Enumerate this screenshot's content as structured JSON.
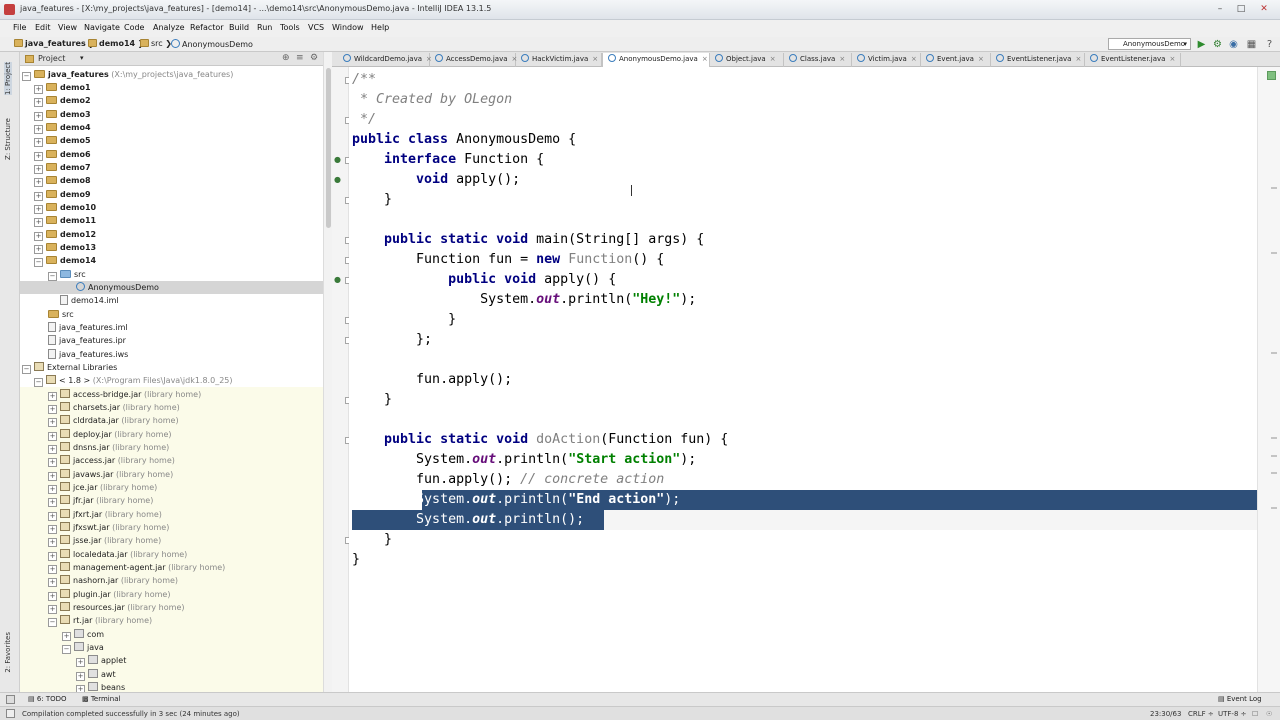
{
  "window": {
    "title": "java_features - [X:\\my_projects\\java_features] - [demo14] - ...\\demo14\\src\\AnonymousDemo.java - IntelliJ IDEA 13.1.5"
  },
  "menu": [
    "File",
    "Edit",
    "View",
    "Navigate",
    "Code",
    "Analyze",
    "Refactor",
    "Build",
    "Run",
    "Tools",
    "VCS",
    "Window",
    "Help"
  ],
  "breadcrumbs": [
    "java_features",
    "demo14",
    "src",
    "AnonymousDemo"
  ],
  "toolbar": {
    "run_config": "AnonymousDemo"
  },
  "side_tabs": {
    "project": "1: Project",
    "structure": "Z: Structure",
    "favorites": "2: Favorites"
  },
  "project_panel": {
    "header": "Project",
    "root": {
      "name": "java_features",
      "path": "(X:\\my_projects\\java_features)"
    },
    "modules": [
      "demo1",
      "demo2",
      "demo3",
      "demo4",
      "demo5",
      "demo6",
      "demo7",
      "demo8",
      "demo9",
      "demo10",
      "demo11",
      "demo12",
      "demo13",
      "demo14"
    ],
    "demo14_src": "src",
    "selected_file": "AnonymousDemo",
    "demo14_iml": "demo14.iml",
    "root_files": [
      "src",
      "java_features.iml",
      "java_features.ipr",
      "java_features.iws"
    ],
    "external_libraries": "External Libraries",
    "jdk": {
      "name": "< 1.8 >",
      "path": "(X:\\Program Files\\Java\\jdk1.8.0_25)"
    },
    "library_home": "(library home)",
    "jars": [
      "access-bridge.jar",
      "charsets.jar",
      "cldrdata.jar",
      "deploy.jar",
      "dnsns.jar",
      "jaccess.jar",
      "javaws.jar",
      "jce.jar",
      "jfr.jar",
      "jfxrt.jar",
      "jfxswt.jar",
      "jsse.jar",
      "localedata.jar",
      "management-agent.jar",
      "nashorn.jar",
      "plugin.jar",
      "resources.jar",
      "rt.jar"
    ],
    "packages": [
      "com",
      "java"
    ],
    "subpackages": [
      "applet",
      "awt",
      "beans"
    ]
  },
  "tabs": [
    "WildcardDemo.java",
    "AccessDemo.java",
    "HackVictim.java",
    "AnonymousDemo.java",
    "Object.java",
    "Class.java",
    "Victim.java",
    "Event.java",
    "EventListener.java",
    "EventListener.java"
  ],
  "code": {
    "l1": "/**",
    "l2": " * Created by OLegon",
    "l3": " */",
    "l4_kw": "public class",
    "l4_rest": " AnonymousDemo {",
    "l5_kw": "interface",
    "l5_rest": " Function {",
    "l6_kw": "void",
    "l6_rest": " apply();",
    "l7": "}",
    "l9_kw": "public static void",
    "l9_rest": " main(String[] args) {",
    "l10_a": "Function fun = ",
    "l10_kw": "new",
    "l10_b": " ",
    "l10_un": "Function",
    "l10_c": "() {",
    "l11_kw": "public void",
    "l11_rest": " apply() {",
    "l12_a": "System.",
    "l12_fd": "out",
    "l12_b": ".println(",
    "l12_st": "\"Hey!\"",
    "l12_c": ");",
    "l13": "}",
    "l14": "};",
    "l16": "fun.apply();",
    "l17": "}",
    "l19_kw": "public static void",
    "l19_un": "doAction",
    "l19_rest": "(Function fun) {",
    "l20_a": "System.",
    "l20_fd": "out",
    "l20_b": ".println(",
    "l20_st": "\"Start action\"",
    "l20_c": ");",
    "l21_a": "fun.apply(); ",
    "l21_cm": "// concrete action",
    "l22_a": "System.",
    "l22_fd": "out",
    "l22_b": ".println(",
    "l22_st": "\"End action\"",
    "l22_c": ");",
    "l23_a": "System.",
    "l23_fd": "out",
    "l23_b": ".println();",
    "l24": "}",
    "l25": "}"
  },
  "bottom_tools": {
    "todo": "6: TODO",
    "terminal": "Terminal",
    "event_log": "Event Log"
  },
  "status": {
    "message": "Compilation completed successfully in 3 sec (24 minutes ago)",
    "position": "23:30/63",
    "line_sep": "CRLF ÷",
    "encoding": "UTF-8 ÷"
  },
  "colors": {
    "selection": "#2e4f79",
    "keyword": "#000080",
    "string": "#008000",
    "comment": "#808080"
  }
}
